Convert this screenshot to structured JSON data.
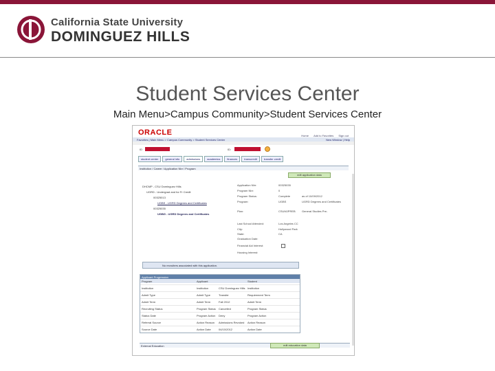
{
  "header": {
    "logo_line1": "California State University",
    "logo_line2": "DOMINGUEZ HILLS"
  },
  "slide": {
    "title": "Student Services Center",
    "breadcrumb": "Main Menu>Campus Community>Student Services Center"
  },
  "screenshot": {
    "brand": "ORACLE",
    "nav": "Favorites | Main Menu > Campus Community > Student Services Center",
    "top_links": [
      "Home",
      "Add to Favorites",
      "Sign out"
    ],
    "nav_right": "New Window | Help",
    "id_label_left": "ID",
    "id_label_right": "ID:",
    "tabs": [
      "student center",
      "general info",
      "admissions",
      "academics",
      "finances",
      "transcredit",
      "transfer credit"
    ],
    "panel_title": "Institution / Career / Application Nbr / Program",
    "edit_application_button": "edit application data",
    "tree": [
      "DHCMP - CSU Dominguez Hills",
      "UGRD - Undergrad and for Fr Credit",
      "00325013",
      "UGBS - UGRD Degrees and Certificates",
      "00325035",
      "UGBG - UGRD Degrees and Certificates"
    ],
    "fields": [
      {
        "label": "Application Nbr:",
        "value": "00325035"
      },
      {
        "label": "Program Nbr:",
        "value": "0"
      },
      {
        "label": "Program Status:",
        "value": "Complete"
      },
      {
        "label": "Program:",
        "value": "UGBS"
      },
      {
        "label": "Plan:",
        "value": "CSUMJPREB"
      }
    ],
    "status_as_of": "as of 10/09/2012",
    "program_desc": "UGRD Degrees and Certificates",
    "plan_desc": "General Studies Pre-",
    "school_fields": [
      {
        "label": "Last School Attended:",
        "value": "Los Angeles CC"
      },
      {
        "label": "City:",
        "value": "Hollywood Park"
      },
      {
        "label": "State:",
        "value": "CA"
      },
      {
        "label": "Graduation Date:",
        "value": ""
      }
    ],
    "financial_aid_label": "Financial Aid Interest:",
    "housing_label": "Housing Interest:",
    "no_recruiters": "No recruiters associated with this application.",
    "applicant_progression": {
      "title": "Applicant Progression",
      "columns": [
        "Program",
        "Applicant",
        "Student"
      ],
      "rows": [
        [
          "Institution",
          "Institution",
          "CSU Dominguez Hills",
          "Institution"
        ],
        [
          "Admit Type",
          "Admit Type",
          "Transfer",
          "Requirement Term"
        ],
        [
          "Admit Term",
          "Admit Term",
          "Fall 2012",
          "Admit Term"
        ],
        [
          "Recruiting Status",
          "Program Status",
          "Cancelled",
          "Program Status"
        ],
        [
          "Status Date",
          "Program Action",
          "Deny",
          "Program Action"
        ],
        [
          "Referral Source",
          "Action Reason",
          "Admissions Revoked",
          "Action Reason"
        ],
        [
          "Source Date",
          "Action Date",
          "04/10/2012",
          "Action Date"
        ]
      ]
    },
    "external_education": "External Education",
    "edit_education_button": "edit education data"
  }
}
